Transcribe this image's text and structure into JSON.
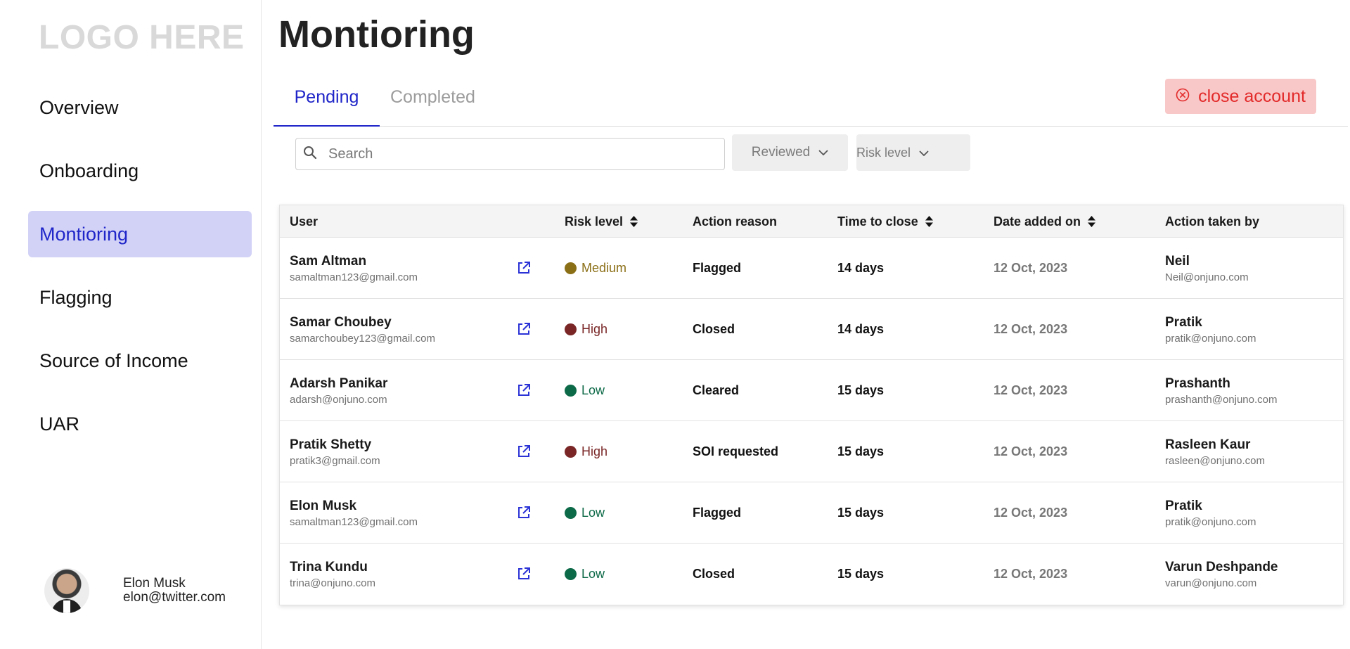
{
  "logo": "LOGO HERE",
  "nav": {
    "items": [
      {
        "label": "Overview"
      },
      {
        "label": "Onboarding"
      },
      {
        "label": "Montioring"
      },
      {
        "label": "Flagging"
      },
      {
        "label": "Source of Income"
      },
      {
        "label": "UAR"
      }
    ],
    "active": "Montioring"
  },
  "current_user": {
    "name": "Elon Musk",
    "email": "elon@twitter.com"
  },
  "page": {
    "title": "Montioring"
  },
  "tabs": [
    {
      "label": "Pending",
      "active": true
    },
    {
      "label": "Completed",
      "active": false
    }
  ],
  "close_account": {
    "label": "close account",
    "icon": "close-circle-icon",
    "color": "#e32a2a",
    "background": "#f8c8c8"
  },
  "search": {
    "placeholder": "Search",
    "value": ""
  },
  "filters": {
    "reviewed": "Reviewed",
    "risk_level": "Risk level"
  },
  "table": {
    "headers": {
      "user": "User",
      "risk_level": "Risk level",
      "action_reason": "Action reason",
      "time_to_close": "Time to close",
      "date_added": "Date added on",
      "action_by": "Action taken by"
    },
    "risk_colors": {
      "Medium": "#8b6f17",
      "High": "#7a2626",
      "Low": "#0d6a48"
    },
    "rows": [
      {
        "name": "Sam Altman",
        "email": "samaltman123@gmail.com",
        "risk": "Medium",
        "reason": "Flagged",
        "time": "14 days",
        "date": "12 Oct, 2023",
        "by_name": "Neil",
        "by_email": "Neil@onjuno.com"
      },
      {
        "name": "Samar Choubey",
        "email": "samarchoubey123@gmail.com",
        "risk": "High",
        "reason": "Closed",
        "time": "14 days",
        "date": "12 Oct, 2023",
        "by_name": "Pratik",
        "by_email": "pratik@onjuno.com"
      },
      {
        "name": "Adarsh Panikar",
        "email": "adarsh@onjuno.com",
        "risk": "Low",
        "reason": "Cleared",
        "time": "15 days",
        "date": "12 Oct, 2023",
        "by_name": "Prashanth",
        "by_email": "prashanth@onjuno.com"
      },
      {
        "name": "Pratik Shetty",
        "email": "pratik3@gmail.com",
        "risk": "High",
        "reason": "SOI requested",
        "time": "15 days",
        "date": "12 Oct, 2023",
        "by_name": "Rasleen Kaur",
        "by_email": "rasleen@onjuno.com"
      },
      {
        "name": "Elon Musk",
        "email": "samaltman123@gmail.com",
        "risk": "Low",
        "reason": "Flagged",
        "time": "15 days",
        "date": "12 Oct, 2023",
        "by_name": "Pratik",
        "by_email": "pratik@onjuno.com"
      },
      {
        "name": "Trina Kundu",
        "email": "trina@onjuno.com",
        "risk": "Low",
        "reason": "Closed",
        "time": "15 days",
        "date": "12 Oct, 2023",
        "by_name": "Varun Deshpande",
        "by_email": "varun@onjuno.com"
      }
    ]
  }
}
